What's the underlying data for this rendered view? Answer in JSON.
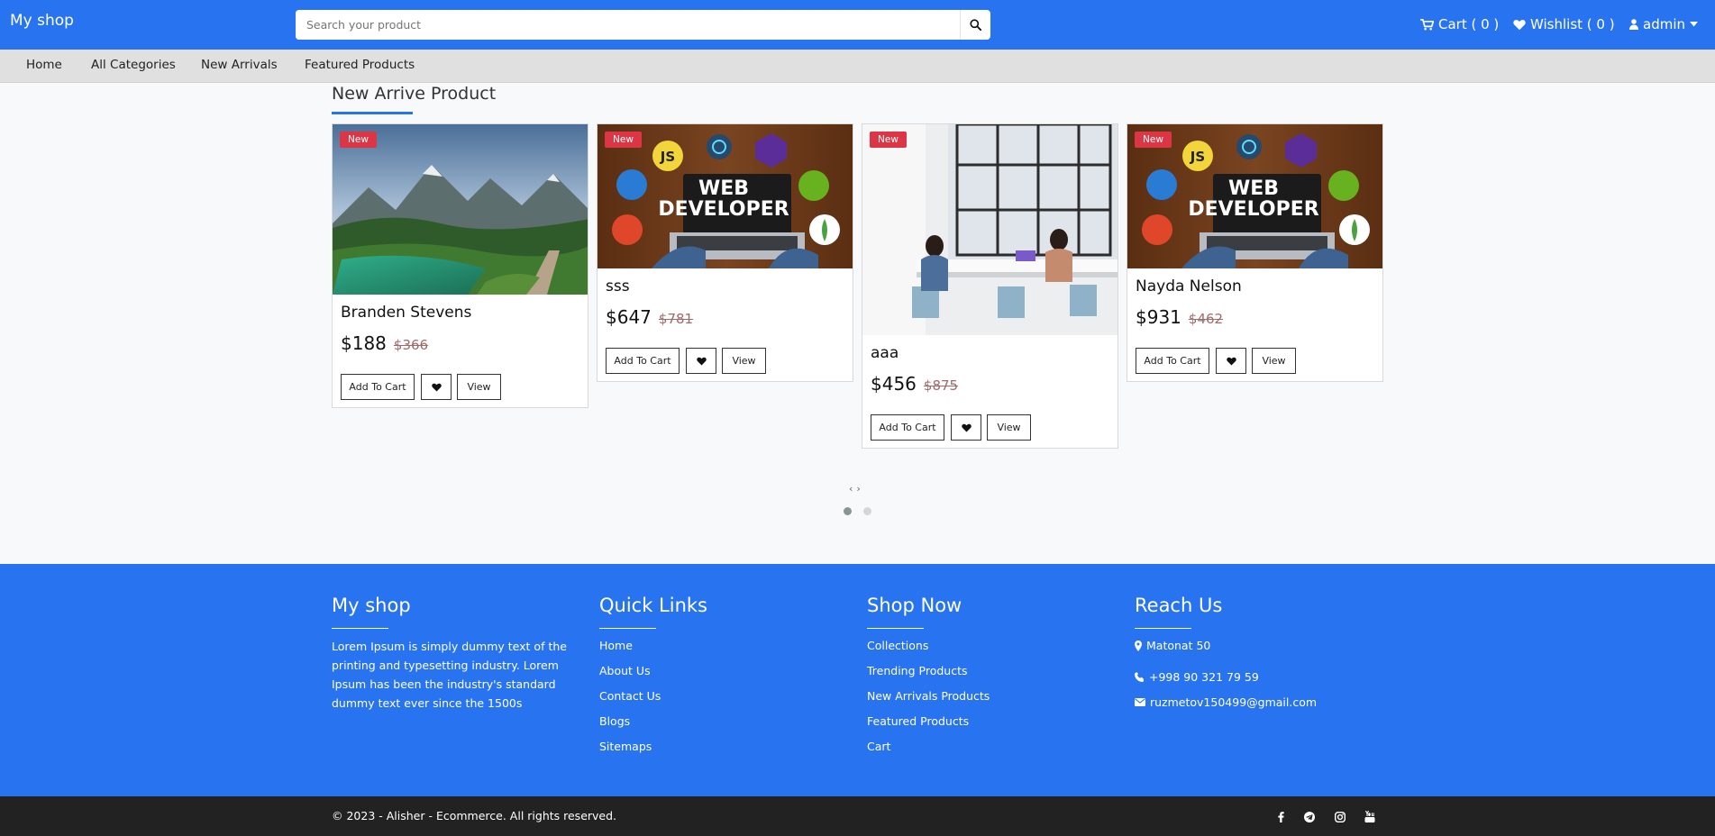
{
  "header": {
    "brand": "My shop",
    "search_placeholder": "Search your product",
    "cart_label": "Cart ( 0 )",
    "wishlist_label": "Wishlist ( 0 )",
    "user_label": "admin"
  },
  "nav": {
    "items": [
      "Home",
      "All Categories",
      "New Arrivals",
      "Featured Products"
    ]
  },
  "section": {
    "title": "New Arrive Product"
  },
  "products": [
    {
      "badge": "New",
      "name": "Branden Stevens",
      "price": "$188",
      "old_price": "$366",
      "image": "landscape-lake-mountains"
    },
    {
      "badge": "New",
      "name": "sss",
      "price": "$647",
      "old_price": "$781",
      "image": "web-developer-banner"
    },
    {
      "badge": "New",
      "name": "aaa",
      "price": "$456",
      "old_price": "$875",
      "image": "office-meeting-room"
    },
    {
      "badge": "New",
      "name": "Nayda Nelson",
      "price": "$931",
      "old_price": "$462",
      "image": "web-developer-banner"
    }
  ],
  "product_buttons": {
    "add_to_cart": "Add To Cart",
    "view": "View"
  },
  "banner_text": {
    "line1": "WEB",
    "line2": "DEVELOPER",
    "js": "JS"
  },
  "carousel": {
    "prev": "‹",
    "next": "›",
    "active_dot": 0,
    "dot_count": 2
  },
  "footer": {
    "col1": {
      "title": "My shop",
      "text": "Lorem Ipsum is simply dummy text of the printing and typesetting industry. Lorem Ipsum has been the industry's standard dummy text ever since the 1500s"
    },
    "col2": {
      "title": "Quick Links",
      "links": [
        "Home",
        "About Us",
        "Contact Us",
        "Blogs",
        "Sitemaps"
      ]
    },
    "col3": {
      "title": "Shop Now",
      "links": [
        "Collections",
        "Trending Products",
        "New Arrivals Products",
        "Featured Products",
        "Cart"
      ]
    },
    "col4": {
      "title": "Reach Us",
      "address": "Matonat 50",
      "phone": "+998 90 321 79 59",
      "email": "ruzmetov150499@gmail.com"
    }
  },
  "bottom": {
    "copyright": "© 2023 - Alisher - Ecommerce. All rights reserved.",
    "social": [
      "facebook-icon",
      "telegram-icon",
      "instagram-icon",
      "youtube-icon"
    ]
  },
  "colors": {
    "primary": "#2874f0",
    "badge": "#dc3545",
    "footer_bottom": "#222222",
    "subnav": "#e0e0e0"
  }
}
